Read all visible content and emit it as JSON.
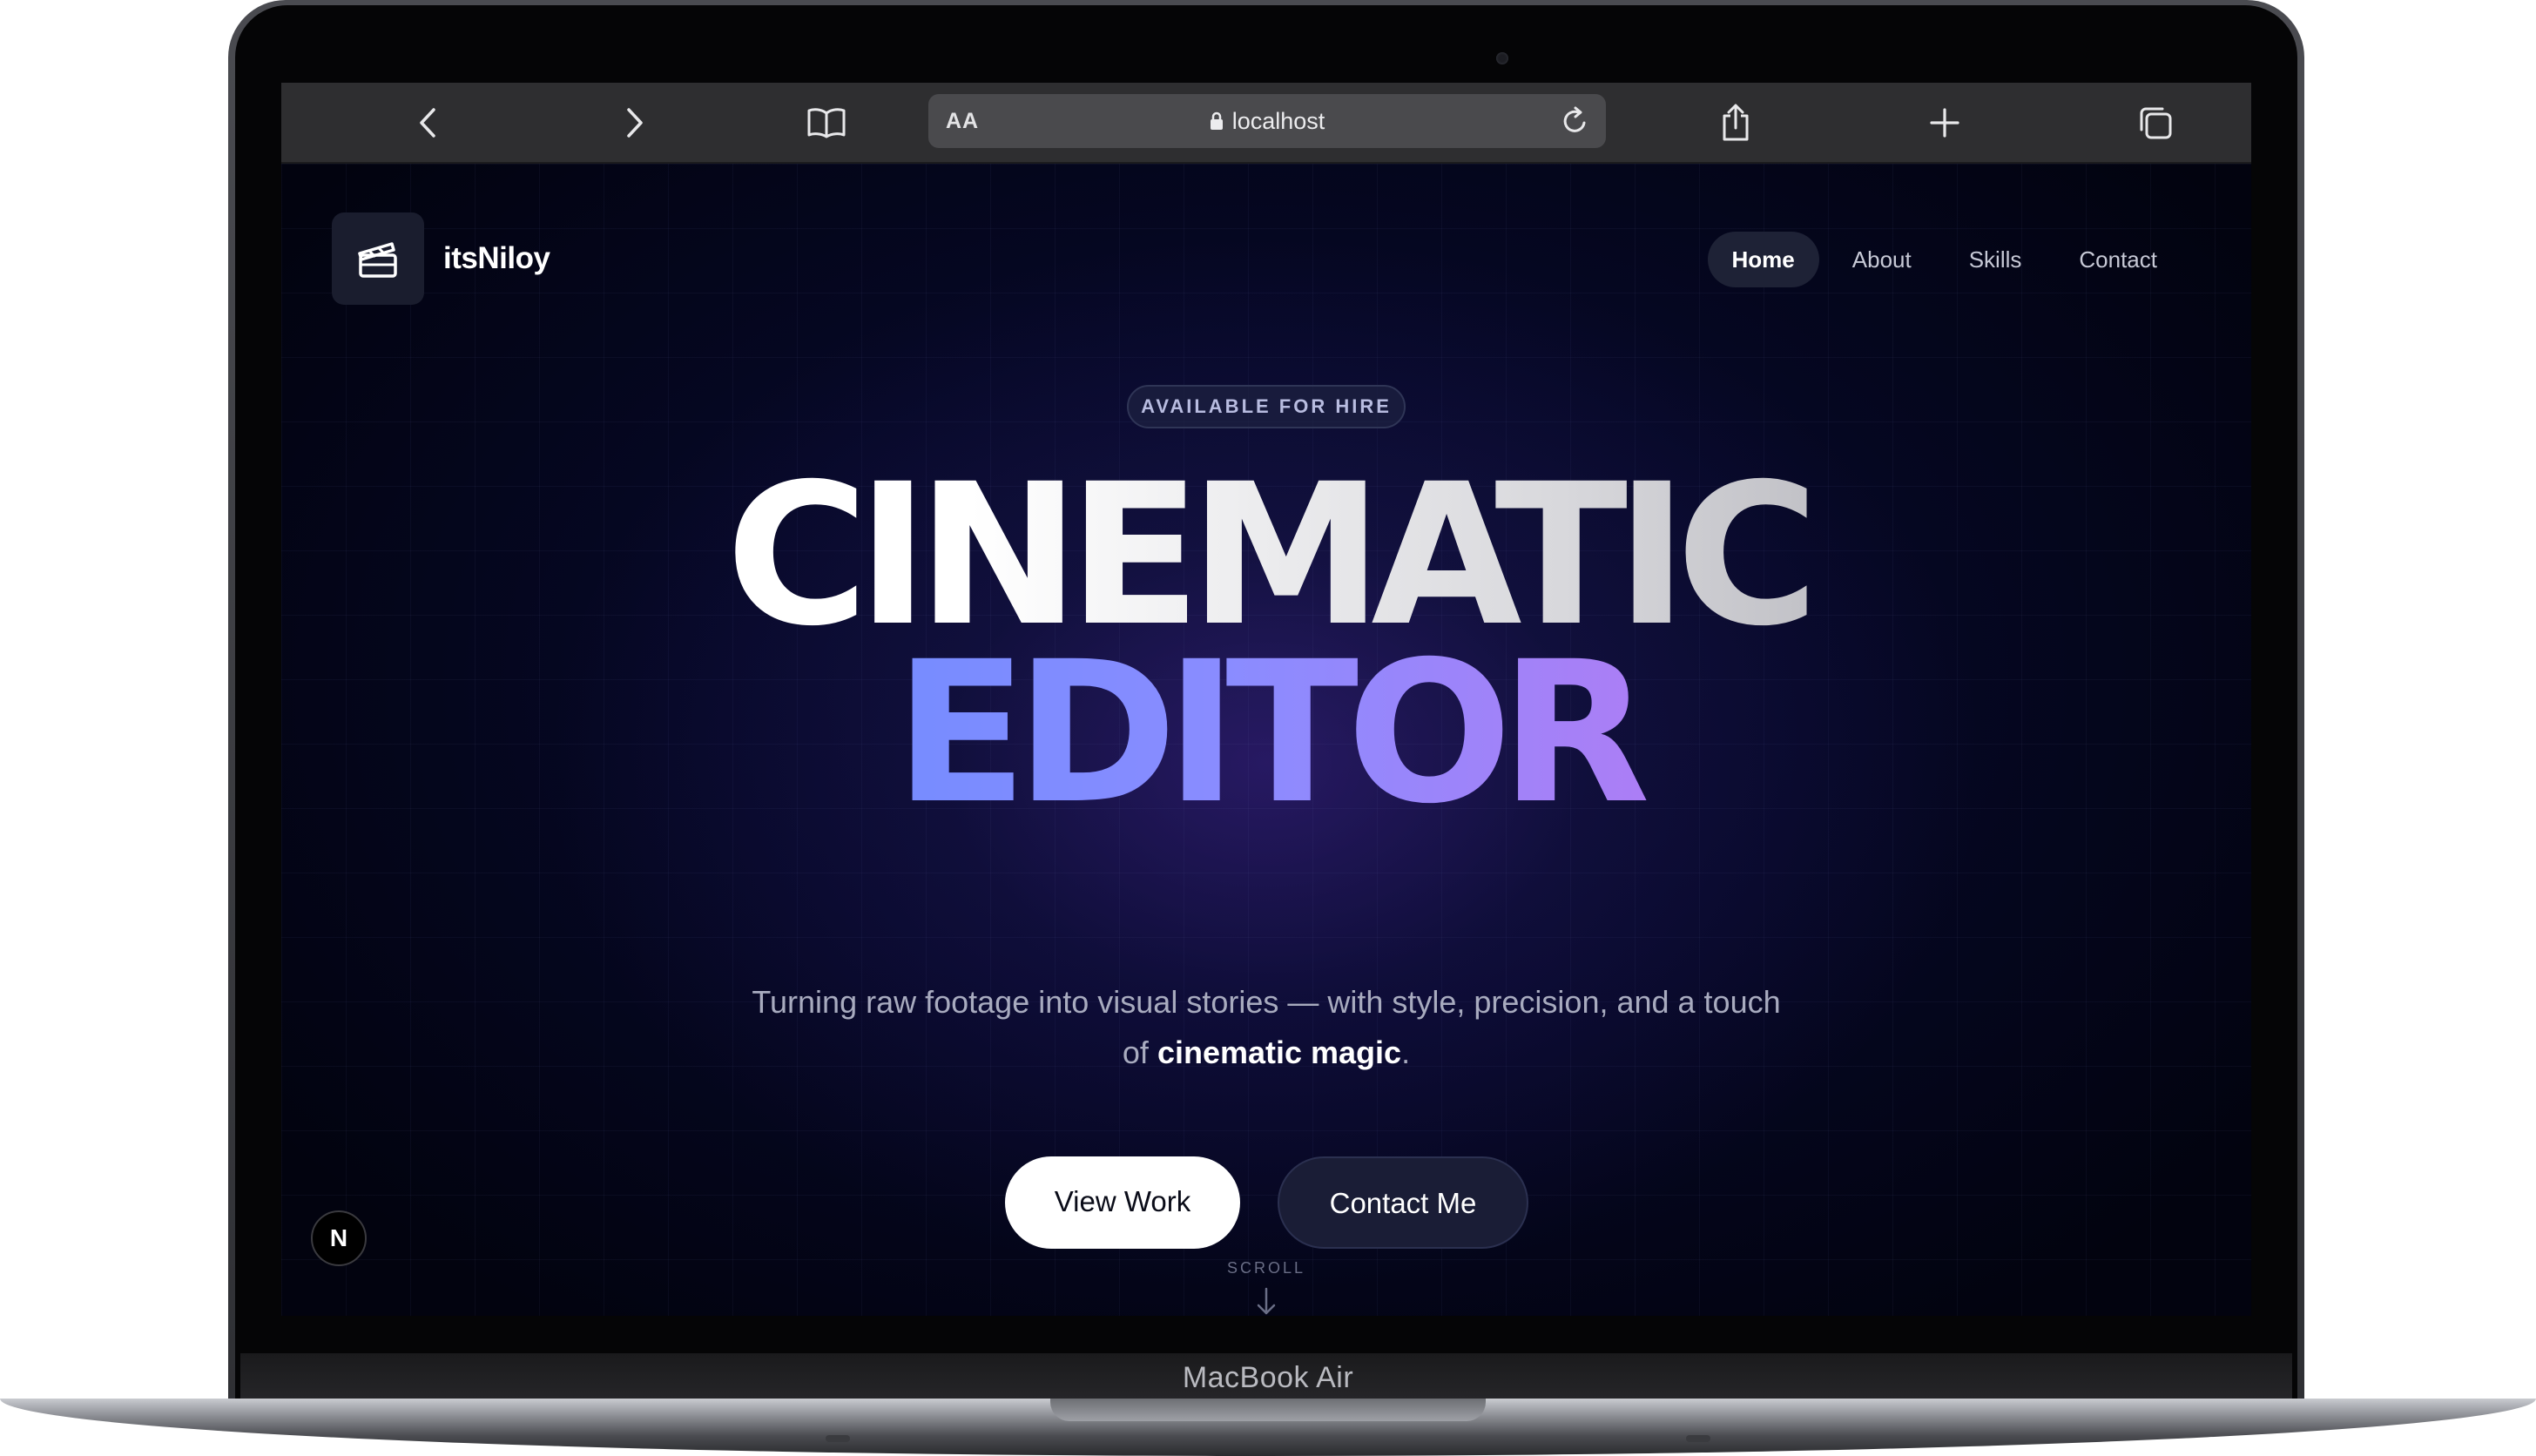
{
  "device": {
    "model_label": "MacBook Air"
  },
  "browser": {
    "text_size_button": "AA",
    "address": "localhost",
    "icons": [
      "back-icon",
      "forward-icon",
      "bookmarks-icon",
      "lock-icon",
      "reload-icon",
      "share-icon",
      "new-tab-icon",
      "tabs-icon"
    ]
  },
  "site": {
    "brand": {
      "name": "itsNiloy",
      "logo_icon": "clapperboard-icon"
    },
    "nav": [
      {
        "label": "Home",
        "active": true
      },
      {
        "label": "About",
        "active": false
      },
      {
        "label": "Skills",
        "active": false
      },
      {
        "label": "Contact",
        "active": false
      }
    ],
    "badge": "AVAILABLE FOR HIRE",
    "headline": {
      "line1": "CINEMATIC",
      "line2": "EDITOR"
    },
    "tagline": {
      "lead": "Turning raw footage into visual stories — with style, precision, and a touch of ",
      "emphasis": "cinematic magic",
      "end": "."
    },
    "buttons": {
      "primary": "View Work",
      "secondary": "Contact Me"
    },
    "fab_label": "N",
    "scroll_hint": "SCROLL",
    "colors": {
      "background": "#02030f",
      "headline_gradient_start": "#6f8cff",
      "headline_gradient_end": "#b07cf4",
      "primary_button": "#ffffff",
      "secondary_button": "#1a1d36"
    }
  }
}
